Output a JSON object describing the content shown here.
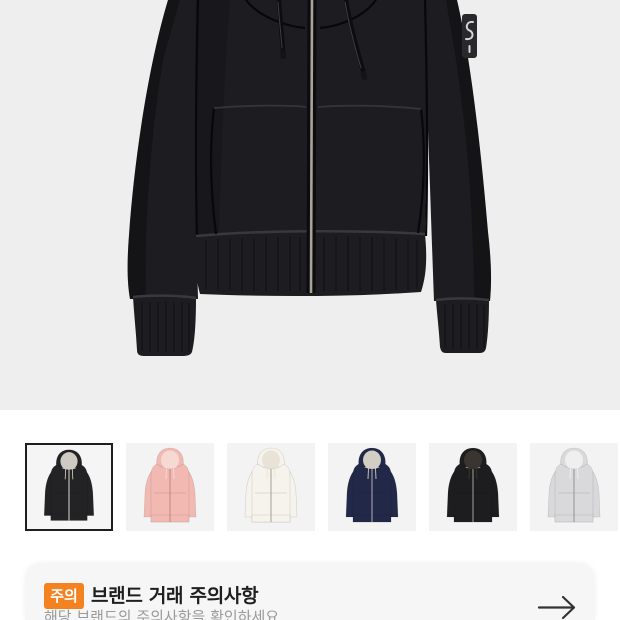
{
  "product_gallery": {
    "main_image": {
      "background": "#eeeeee",
      "jacket_color": "#1d1d21",
      "zipper_color": "#a9a49a"
    },
    "thumbnails": [
      {
        "body_color": "#232326",
        "lining_color": "#cfcac2",
        "zipper_color": "#c8c3ba",
        "selected": true
      },
      {
        "body_color": "#f2b9b3",
        "lining_color": "#f7d9d4",
        "zipper_color": "#c98e88",
        "selected": false
      },
      {
        "body_color": "#f6f3ed",
        "lining_color": "#e9e3d7",
        "zipper_color": "#b3ac9f",
        "selected": false
      },
      {
        "body_color": "#222847",
        "lining_color": "#d3cec4",
        "zipper_color": "#9a98a0",
        "selected": false
      },
      {
        "body_color": "#1d1d1f",
        "lining_color": "#3b3532",
        "zipper_color": "#8f8a84",
        "selected": false
      },
      {
        "body_color": "#d9d9db",
        "lining_color": "#efefef",
        "zipper_color": "#9e9ea2",
        "selected": false
      }
    ]
  },
  "notice_card": {
    "badge_label": "주의",
    "badge_color": "#f58220",
    "title": "브랜드 거래 주의사항",
    "subtitle": "해당 브랜드의 주의사항을 확인하세요",
    "icon": "arrow-right-icon"
  }
}
